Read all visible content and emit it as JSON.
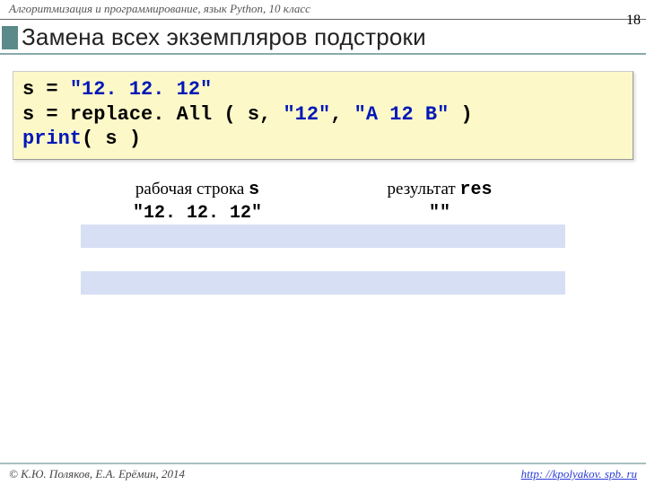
{
  "header": {
    "course": "Алгоритмизация и программирование, язык Python, 10 класс",
    "page": "18"
  },
  "title": "Замена всех экземпляров подстроки",
  "code": {
    "l1a": "s = ",
    "l1b": "\"12. 12. 12\"",
    "l2a": "s = replace. All ( s, ",
    "l2b": "\"12\"",
    "l2c": ", ",
    "l2d": "\"A 12 B\"",
    "l2e": " )",
    "l3a": "print",
    "l3b": "( s )"
  },
  "table": {
    "h1a": "рабочая строка ",
    "h1b": "s",
    "h2a": "результат ",
    "h2b": "res",
    "r1c1": "\"12. 12. 12\"",
    "r1c2": "\"\""
  },
  "footer": {
    "left": "© К.Ю. Поляков, Е.А. Ерёмин, 2014",
    "right": "http: //kpolyakov. spb. ru"
  }
}
